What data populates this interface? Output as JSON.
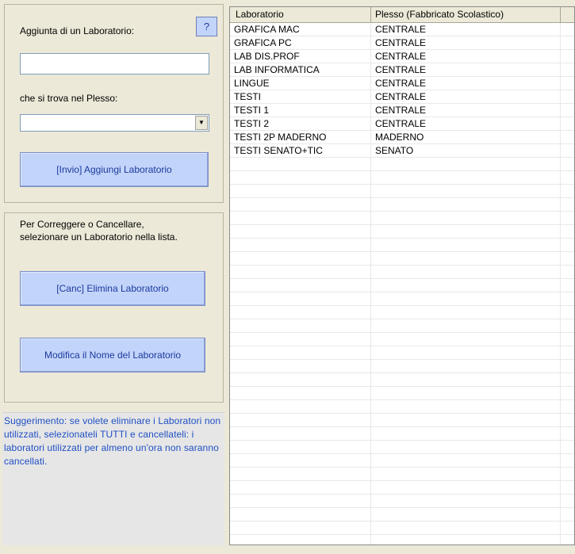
{
  "add_panel": {
    "title": "Aggiunta di un Laboratorio:",
    "help_label": "?",
    "name_input_value": "",
    "plesso_label": "che si trova nel Plesso:",
    "plesso_select_value": "",
    "add_button": "[Invio] Aggiungi Laboratorio"
  },
  "edit_panel": {
    "instructions_line1": "Per Correggere o Cancellare,",
    "instructions_line2": "selezionare un Laboratorio nella lista.",
    "delete_button": "[Canc] Elimina Laboratorio",
    "rename_button": "Modifica il Nome del Laboratorio"
  },
  "hint": {
    "text": "Suggerimento: se volete eliminare i Laboratori non utilizzati, selezionateli TUTTI e cancellateli: i laboratori utilizzati per almeno un'ora non saranno cancellati."
  },
  "grid": {
    "columns": [
      "Laboratorio",
      "Plesso (Fabbricato Scolastico)"
    ],
    "rows": [
      [
        "GRAFICA MAC",
        "CENTRALE"
      ],
      [
        "GRAFICA PC",
        "CENTRALE"
      ],
      [
        "LAB DIS.PROF",
        "CENTRALE"
      ],
      [
        "LAB INFORMATICA",
        "CENTRALE"
      ],
      [
        "LINGUE",
        "CENTRALE"
      ],
      [
        "TESTI",
        "CENTRALE"
      ],
      [
        "TESTI 1",
        "CENTRALE"
      ],
      [
        "TESTI 2",
        "CENTRALE"
      ],
      [
        "TESTI 2P MADERNO",
        "MADERNO"
      ],
      [
        "TESTI SENATO+TIC",
        "SENATO"
      ],
      [
        "",
        ""
      ],
      [
        "",
        ""
      ],
      [
        "",
        ""
      ],
      [
        "",
        ""
      ],
      [
        "",
        ""
      ],
      [
        "",
        ""
      ],
      [
        "",
        ""
      ],
      [
        "",
        ""
      ],
      [
        "",
        ""
      ],
      [
        "",
        ""
      ],
      [
        "",
        ""
      ],
      [
        "",
        ""
      ],
      [
        "",
        ""
      ],
      [
        "",
        ""
      ],
      [
        "",
        ""
      ],
      [
        "",
        ""
      ],
      [
        "",
        ""
      ],
      [
        "",
        ""
      ],
      [
        "",
        ""
      ],
      [
        "",
        ""
      ],
      [
        "",
        ""
      ],
      [
        "",
        ""
      ],
      [
        "",
        ""
      ],
      [
        "",
        ""
      ],
      [
        "",
        ""
      ],
      [
        "",
        ""
      ],
      [
        "",
        ""
      ],
      [
        "",
        ""
      ],
      [
        "",
        ""
      ]
    ]
  }
}
